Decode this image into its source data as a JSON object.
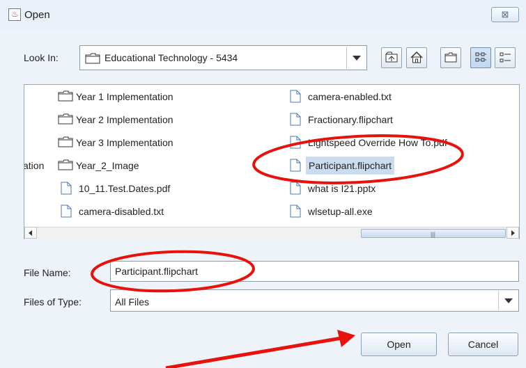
{
  "window": {
    "title": "Open",
    "close_glyph": "⊠"
  },
  "look_in": {
    "label": "Look In:",
    "value": "Educational Technology - 5434"
  },
  "file_list": {
    "left_column": [
      {
        "name": "Year 1 Implementation",
        "icon": "folder-icon"
      },
      {
        "name": "Year 2 Implementation",
        "icon": "folder-icon"
      },
      {
        "name": "Year 3 Implementation",
        "icon": "folder-icon"
      },
      {
        "name": "Year_2_Image",
        "icon": "folder-icon",
        "prefix": "ation"
      },
      {
        "name": "10_11.Test.Dates.pdf",
        "icon": "file-icon"
      },
      {
        "name": "camera-disabled.txt",
        "icon": "file-icon"
      }
    ],
    "right_column": [
      {
        "name": "camera-enabled.txt",
        "icon": "file-icon"
      },
      {
        "name": "Fractionary.flipchart",
        "icon": "file-icon"
      },
      {
        "name": "Lightspeed Override How To.pdf",
        "icon": "file-icon"
      },
      {
        "name": "Participant.flipchart",
        "icon": "file-icon",
        "selected": true
      },
      {
        "name": "what is I21.pptx",
        "icon": "file-icon"
      },
      {
        "name": "wlsetup-all.exe",
        "icon": "file-icon"
      }
    ]
  },
  "scrollbar": {
    "thumb_grip": "|||"
  },
  "file_name": {
    "label": "File Name:",
    "value": "Participant.flipchart"
  },
  "files_of_type": {
    "label": "Files of Type:",
    "value": "All Files"
  },
  "buttons": {
    "open": "Open",
    "cancel": "Cancel"
  },
  "colors": {
    "annotation_red": "#e8120c",
    "selection_bg": "#cbdcf0",
    "dialog_bg": "#eef3f9"
  }
}
